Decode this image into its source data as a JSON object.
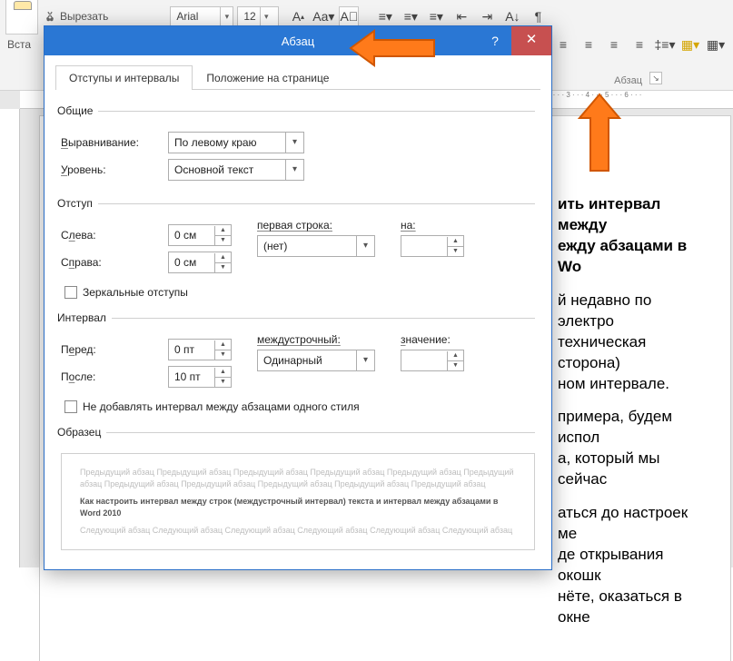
{
  "ribbon": {
    "paste_label": "Вста",
    "cut_label": "Вырезать",
    "font_name": "Arial",
    "font_size": "12",
    "group_paragraph": "Абзац"
  },
  "ruler_ticks": "2 · · · 3 · · · 4 · · · 5 · · · 6 · · ·",
  "doc": {
    "p1a": "ить интервал между",
    "p1b": "ежду абзацами в Wo",
    "p2a": "й недавно по электро",
    "p2b": "техническая сторона)",
    "p2c": "ном интервале.",
    "p3a": "примера, будем испол",
    "p3b": "а, который мы сейчас",
    "p4a": "аться до настроек ме",
    "p4b": "де открывания окошк",
    "p4c": "нёте, оказаться в окне"
  },
  "dialog": {
    "title": "Абзац",
    "tab1": "Отступы и интервалы",
    "tab2": "Положение на странице",
    "g_general": "Общие",
    "lbl_align": "Выравнивание:",
    "val_align": "По левому краю",
    "lbl_level": "Уровень:",
    "val_level": "Основной текст",
    "g_indent": "Отступ",
    "lbl_left": "Слева:",
    "val_left": "0 см",
    "lbl_right": "Справа:",
    "val_right": "0 см",
    "lbl_firstline": "первая строка:",
    "val_firstline": "(нет)",
    "lbl_on": "на:",
    "val_on": "",
    "chk_mirror": "Зеркальные отступы",
    "g_spacing": "Интервал",
    "lbl_before": "Перед:",
    "val_before": "0 пт",
    "lbl_after": "После:",
    "val_after": "10 пт",
    "lbl_linespacing": "междустрочный:",
    "val_linespacing": "Одинарный",
    "lbl_value": "значение:",
    "val_value": "",
    "chk_nospace": "Не добавлять интервал между абзацами одного стиля",
    "g_preview": "Образец",
    "prev_before": "Предыдущий абзац Предыдущий абзац Предыдущий абзац Предыдущий абзац Предыдущий абзац Предыдущий абзац Предыдущий абзац Предыдущий абзац Предыдущий абзац Предыдущий абзац Предыдущий абзац",
    "prev_bold": "Как настроить интервал между строк (междустрочный интервал) текста и интервал между абзацами в Word 2010",
    "prev_after": "Следующий абзац Следующий абзац Следующий абзац Следующий абзац Следующий абзац Следующий абзац"
  },
  "colors": {
    "accent": "#2a77d4",
    "close": "#c75050",
    "arrow": "#ff7a1a"
  }
}
